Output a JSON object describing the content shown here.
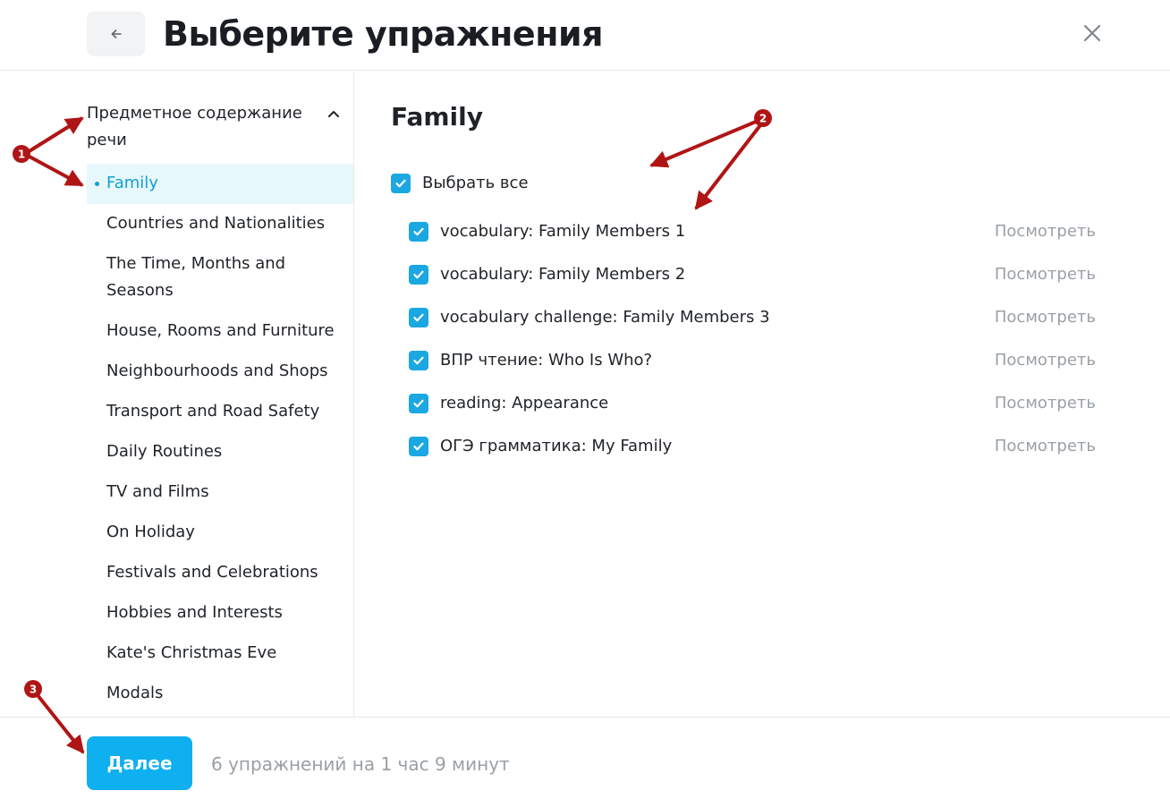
{
  "header": {
    "back_icon": "arrow-left-icon",
    "title": "Выберите упражнения",
    "close_icon": "close-icon"
  },
  "sidebar": {
    "section_title": "Предметное содержание речи",
    "section_icon": "chevron-up-icon",
    "topics": [
      {
        "label": "Family",
        "active": true
      },
      {
        "label": "Countries and Nationalities"
      },
      {
        "label": "The Time, Months and Seasons"
      },
      {
        "label": "House, Rooms and Furniture"
      },
      {
        "label": "Neighbourhoods and Shops"
      },
      {
        "label": "Transport and Road Safety"
      },
      {
        "label": "Daily Routines"
      },
      {
        "label": "TV and Films"
      },
      {
        "label": "On Holiday"
      },
      {
        "label": "Festivals and Celebrations"
      },
      {
        "label": "Hobbies and Interests"
      },
      {
        "label": "Kate's Christmas Eve"
      },
      {
        "label": "Modals"
      }
    ]
  },
  "main": {
    "title": "Family",
    "select_all": {
      "label": "Выбрать все",
      "checked": true
    },
    "view_label": "Посмотреть",
    "exercises": [
      {
        "label": "vocabulary: Family Members 1",
        "checked": true
      },
      {
        "label": "vocabulary: Family Members 2",
        "checked": true
      },
      {
        "label": "vocabulary challenge: Family Members 3",
        "checked": true
      },
      {
        "label": "ВПР чтение: Who Is Who?",
        "checked": true
      },
      {
        "label": "reading: Appearance",
        "checked": true
      },
      {
        "label": "ОГЭ грамматика: My Family",
        "checked": true
      }
    ]
  },
  "footer": {
    "next_label": "Далее",
    "summary": "6 упражнений на 1 час 9 минут"
  },
  "annotations": {
    "markers": [
      "1",
      "2",
      "3"
    ],
    "color": "#b01515"
  },
  "colors": {
    "accent": "#0eb0ef",
    "checkbox": "#1ba7e2",
    "active_bg": "#e6f8fc",
    "active_text": "#119fd0",
    "muted_text": "#9aa0a6"
  }
}
